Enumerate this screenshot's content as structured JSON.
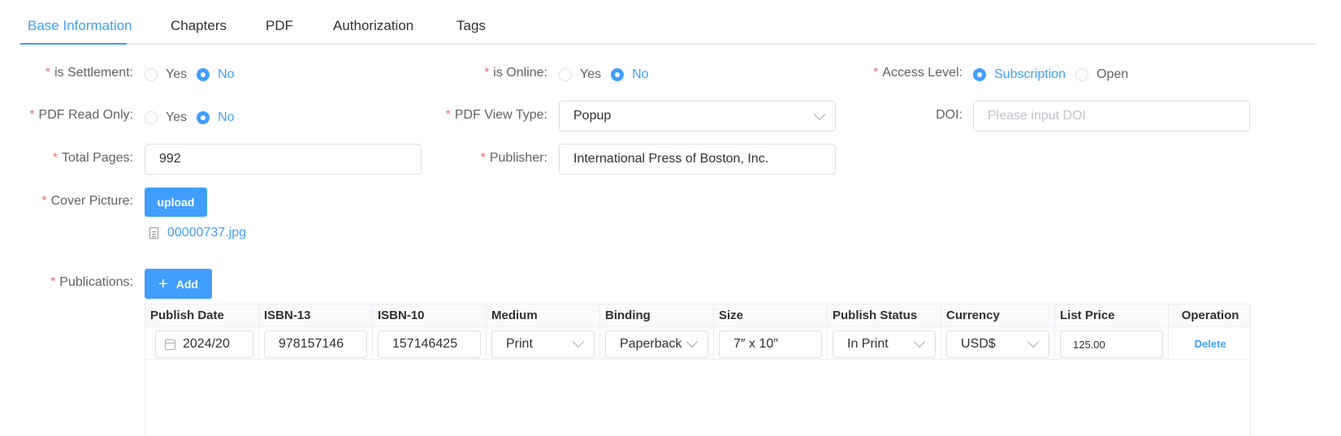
{
  "tabs": [
    "Base Information",
    "Chapters",
    "PDF",
    "Authorization",
    "Tags"
  ],
  "active_tab": "Base Information",
  "form": {
    "is_settlement": {
      "label": "is Settlement:",
      "options": [
        "Yes",
        "No"
      ],
      "selected": "No"
    },
    "is_online": {
      "label": "is Online:",
      "options": [
        "Yes",
        "No"
      ],
      "selected": "No"
    },
    "access_level": {
      "label": "Access Level:",
      "options": [
        "Subscription",
        "Open"
      ],
      "selected": "Subscription"
    },
    "pdf_read_only": {
      "label": "PDF Read Only:",
      "options": [
        "Yes",
        "No"
      ],
      "selected": "No"
    },
    "pdf_view_type": {
      "label": "PDF View Type:",
      "value": "Popup"
    },
    "doi": {
      "label": "DOI:",
      "value": "",
      "placeholder": "Please input DOI"
    },
    "total_pages": {
      "label": "Total Pages:",
      "value": "992"
    },
    "publisher": {
      "label": "Publisher:",
      "value": "International Press of Boston, Inc."
    },
    "cover_picture": {
      "label": "Cover Picture:",
      "button": "upload",
      "file": "00000737.jpg"
    },
    "publications": {
      "label": "Publications:",
      "add_button": "Add"
    }
  },
  "table": {
    "columns": [
      "Publish Date",
      "ISBN-13",
      "ISBN-10",
      "Medium",
      "Binding",
      "Size",
      "Publish Status",
      "Currency",
      "List Price",
      "Operation"
    ],
    "rows": [
      {
        "publish_date": "2024/20",
        "isbn13": "978157146",
        "isbn10": "157146425",
        "medium": "Print",
        "binding": "Paperback",
        "size": "7″ x 10″",
        "publish_status": "In Print",
        "currency": "USD$",
        "list_price": "125.00",
        "operation": "Delete"
      }
    ]
  },
  "colors": {
    "accent": "#409eff",
    "required": "#f56c6c",
    "border": "#dcdfe6"
  }
}
